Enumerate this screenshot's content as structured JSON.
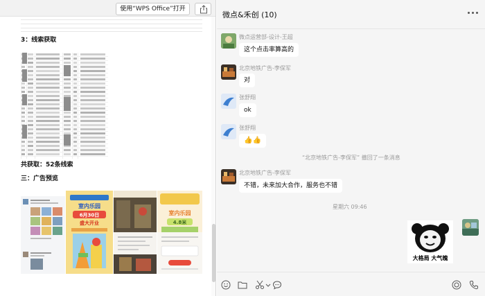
{
  "document": {
    "open_button_label": "使用“WPS Office”打开",
    "heading_leads": "3：线索获取",
    "total_leads": "共获取：52条线索",
    "heading_ads": "三：广告预览",
    "ad_banners": [
      {
        "title": "室内乐园",
        "date": "6月30日",
        "event": "盛大开业"
      },
      {
        "title": "室内乐园",
        "size": "4.8米"
      }
    ]
  },
  "chat": {
    "title": "微点&禾创 (10)",
    "messages": [
      {
        "sender": "微点运营部-设计-王超",
        "text": "这个点击率算高的"
      },
      {
        "sender": "北京地铁广告-李保军",
        "text": "对"
      },
      {
        "sender": "张舒翔",
        "text": "ok"
      },
      {
        "sender": "张舒翔",
        "text": "👍👍"
      }
    ],
    "recall_notice": "“北京地铁广告-李保军” 撤回了一条消息",
    "message_after_recall": {
      "sender": "北京地铁广告-李保军",
      "text": "不错，未来加大合作，服务也不错"
    },
    "timestamp": "星期六 09:46",
    "sticker_caption": "大格局 大气魄"
  },
  "icons": {
    "toolbar": [
      "emoji-icon",
      "folder-icon",
      "scissors-icon",
      "chat-bubble-icon",
      "video-call-icon",
      "phone-icon"
    ]
  },
  "colors": {
    "chat_bg": "#f5f5f5",
    "bubble_bg": "#ffffff",
    "doc_bg": "#ffffff"
  }
}
